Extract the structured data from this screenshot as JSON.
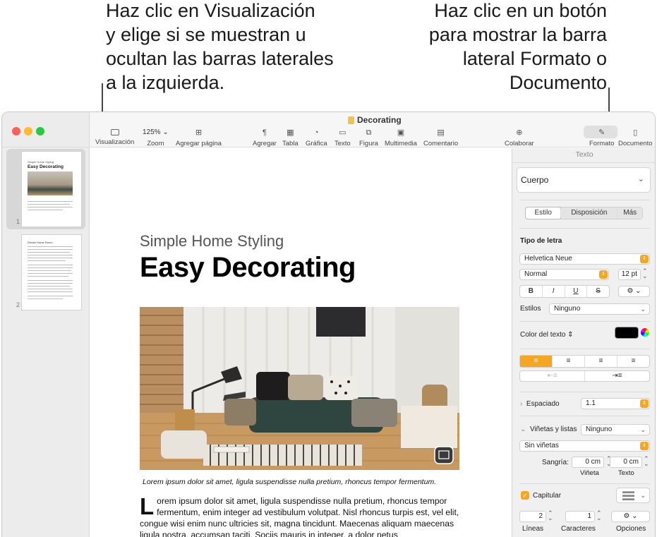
{
  "callouts": {
    "left": [
      "Haz clic en Visualización",
      "y elige si se muestran u",
      "ocultan las barras laterales",
      "a la izquierda."
    ],
    "right": [
      "Haz clic en un botón",
      "para mostrar la barra",
      "lateral Formato o",
      "Documento"
    ]
  },
  "window": {
    "title": "Decorating"
  },
  "toolbar": {
    "view": "Visualización",
    "zoom_value": "125%",
    "zoom": "Zoom",
    "add_page": "Agregar página",
    "insert": "Agregar",
    "table": "Tabla",
    "chart": "Gráfica",
    "text": "Texto",
    "shape": "Figura",
    "media": "Multimedia",
    "comment": "Comentario",
    "collaborate": "Colaborar",
    "format": "Formato",
    "document": "Documento"
  },
  "thumbnails": {
    "page1_num": "1",
    "page2_num": "2",
    "page1_sub": "Simple Home Styling",
    "page1_title": "Easy Decorating",
    "page2_title": "Dream Home Room"
  },
  "document": {
    "subtitle": "Simple Home Styling",
    "title": "Easy Decorating",
    "caption": "Lorem ipsum dolor sit amet, ligula suspendisse nulla pretium, rhoncus tempor fermentum.",
    "dropcap": "L",
    "body": "orem ipsum dolor sit amet, ligula suspendisse nulla pretium, rhoncus tempor fermentum, enim integer ad vestibulum volutpat. Nisl rhoncus turpis est, vel elit, congue wisi enim nunc ultricies sit, magna tincidunt. Maecenas aliquam maecenas ligula nostra, accumsan taciti. Sociis mauris in integer, a dolor netus"
  },
  "inspector": {
    "header": "Texto",
    "paragraph_style": "Cuerpo",
    "tabs": [
      "Estilo",
      "Disposición",
      "Más"
    ],
    "font_section": "Tipo de letra",
    "font_name": "Helvetica Neue",
    "font_weight": "Normal",
    "font_size": "12 pt",
    "bold": "B",
    "italic": "I",
    "underline": "U",
    "strike": "S",
    "styles_label": "Estilos",
    "styles_value": "Ninguno",
    "text_color_label": "Color del texto",
    "text_color": "#000000",
    "spacing_label": "Espaciado",
    "spacing_value": "1.1",
    "bullets_label": "Viñetas y listas",
    "bullets_value": "Ninguno",
    "bullet_type": "Sin viñetas",
    "indent_label": "Sangría:",
    "indent_bullet_value": "0 cm",
    "indent_text_value": "0 cm",
    "indent_bullet_label": "Viñeta",
    "indent_text_label": "Texto",
    "dropcap_label": "Capitular",
    "lines_value": "2",
    "chars_value": "1",
    "lines_label": "Líneas",
    "chars_label": "Caracteres",
    "options_label": "Opciones"
  },
  "colors": {
    "accent": "#f6a623"
  }
}
